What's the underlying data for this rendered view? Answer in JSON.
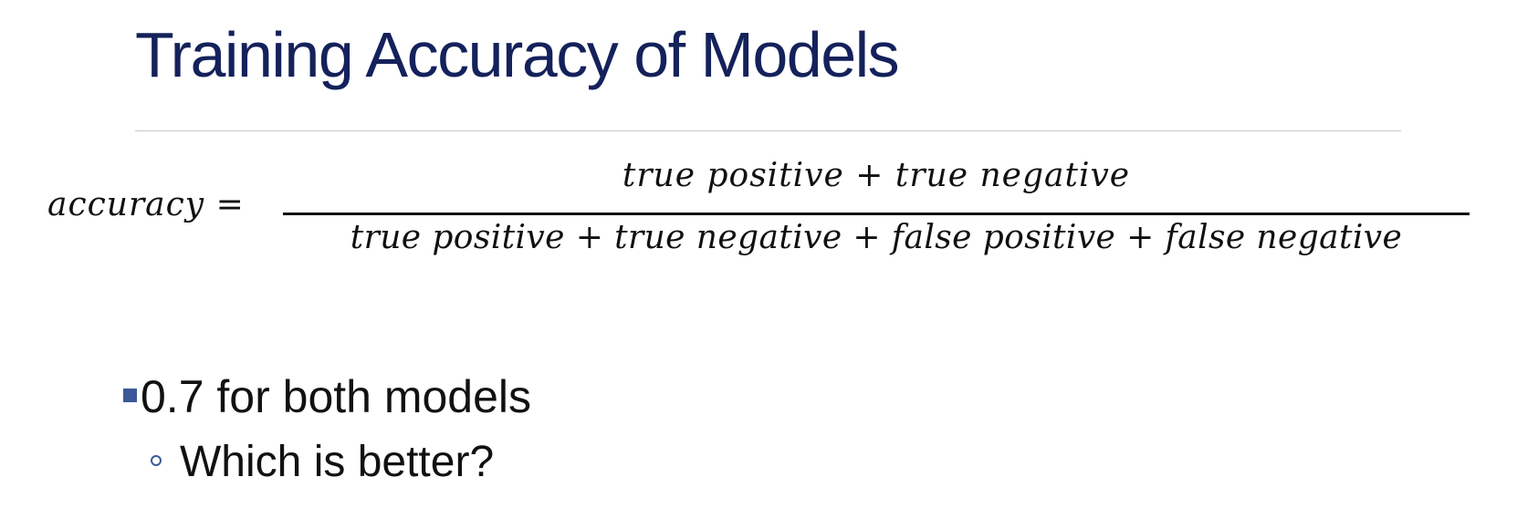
{
  "slide": {
    "title": "Training Accuracy of Models",
    "formula": {
      "lhs": "accuracy =",
      "numerator": "true positive + true negative",
      "denominator": "true positive + true negative + false positive + false negative"
    },
    "bullets": [
      {
        "text": "0.7 for both models",
        "subbullets": [
          {
            "text": "Which is better?"
          }
        ]
      }
    ],
    "colors": {
      "title": "#14215b",
      "bullet_accent": "#3b5998",
      "divider": "#c9c9c9"
    }
  }
}
